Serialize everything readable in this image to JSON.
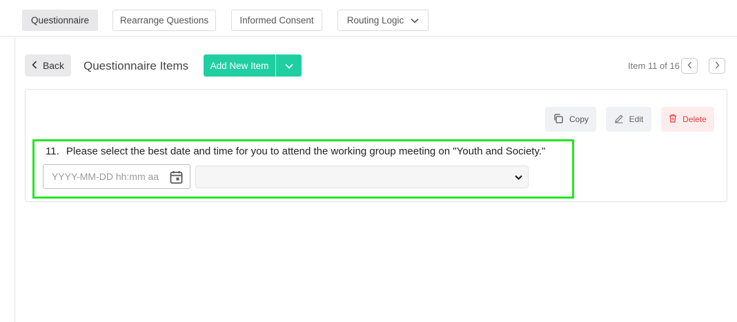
{
  "tabs": [
    {
      "label": "Questionnaire",
      "active": true
    },
    {
      "label": "Rearrange Questions",
      "active": false
    },
    {
      "label": "Informed Consent",
      "active": false
    },
    {
      "label": "Routing Logic",
      "active": false,
      "icon": "chevron-down-icon"
    }
  ],
  "toolbar": {
    "back_label": "Back",
    "title": "Questionnaire Items",
    "add_label": "Add New Item",
    "pager_text": "Item 11 of 16"
  },
  "actions": {
    "copy_label": "Copy",
    "edit_label": "Edit",
    "delete_label": "Delete"
  },
  "question": {
    "number": "11.",
    "text": "Please select the best date and time for you to attend the working group meeting on \"Youth and Society.\"",
    "date_placeholder": "YYYY-MM-DD hh:mm aa",
    "time_value": ""
  },
  "colors": {
    "accent": "#1fcfa1",
    "highlight": "#22e622",
    "danger": "#e23b3b"
  }
}
